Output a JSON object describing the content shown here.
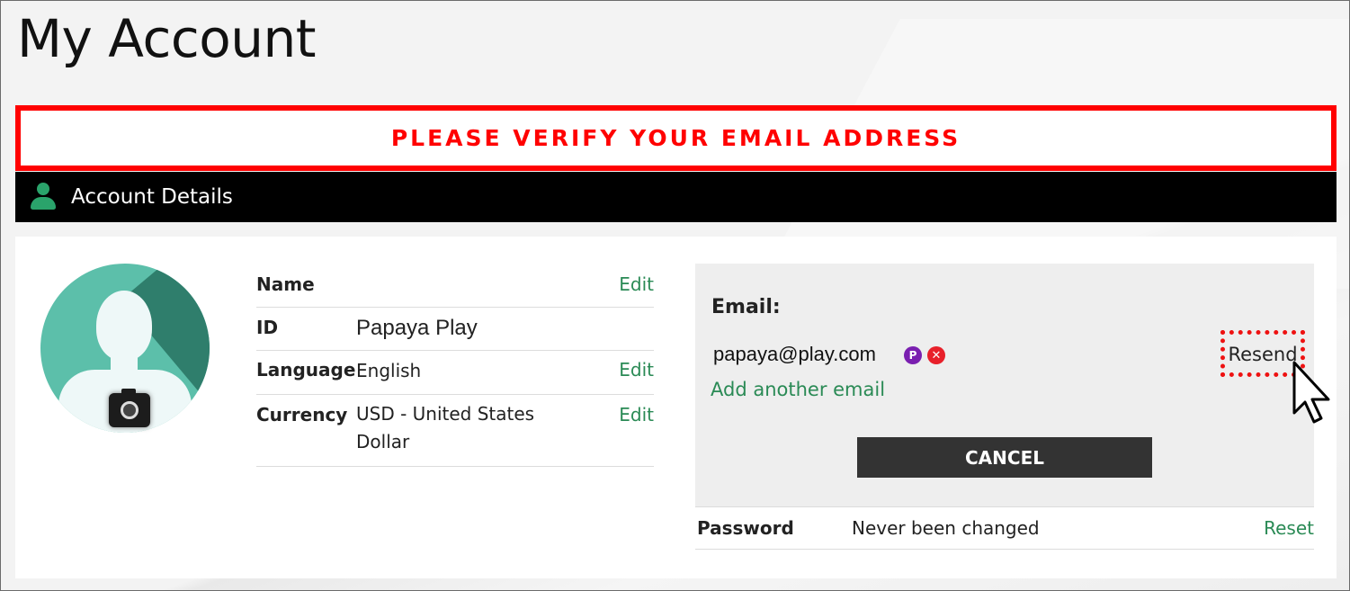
{
  "page": {
    "title": "My Account"
  },
  "alert": {
    "text": "PLEASE VERIFY YOUR EMAIL ADDRESS"
  },
  "section": {
    "title": "Account Details",
    "icon": "user-icon"
  },
  "avatar": {
    "icon": "camera-icon"
  },
  "details": {
    "name": {
      "label": "Name",
      "value": "",
      "action": "Edit"
    },
    "id": {
      "label": "ID",
      "value": "Papaya Play"
    },
    "language": {
      "label": "Language",
      "value": "English",
      "action": "Edit"
    },
    "currency": {
      "label": "Currency",
      "value": "USD - United States Dollar",
      "action": "Edit"
    }
  },
  "email": {
    "label": "Email:",
    "address": "papaya@play.com",
    "primary_badge": "P",
    "remove_badge": "✕",
    "add_link": "Add another email",
    "resend_link": "Resend",
    "cancel_label": "CANCEL"
  },
  "password": {
    "label": "Password",
    "value": "Never been changed",
    "action": "Reset"
  },
  "colors": {
    "alert": "#ff0000",
    "link": "#2a8a55",
    "header_bar": "#000000",
    "primary_badge": "#7a1fb0",
    "remove_badge": "#e8202a"
  }
}
